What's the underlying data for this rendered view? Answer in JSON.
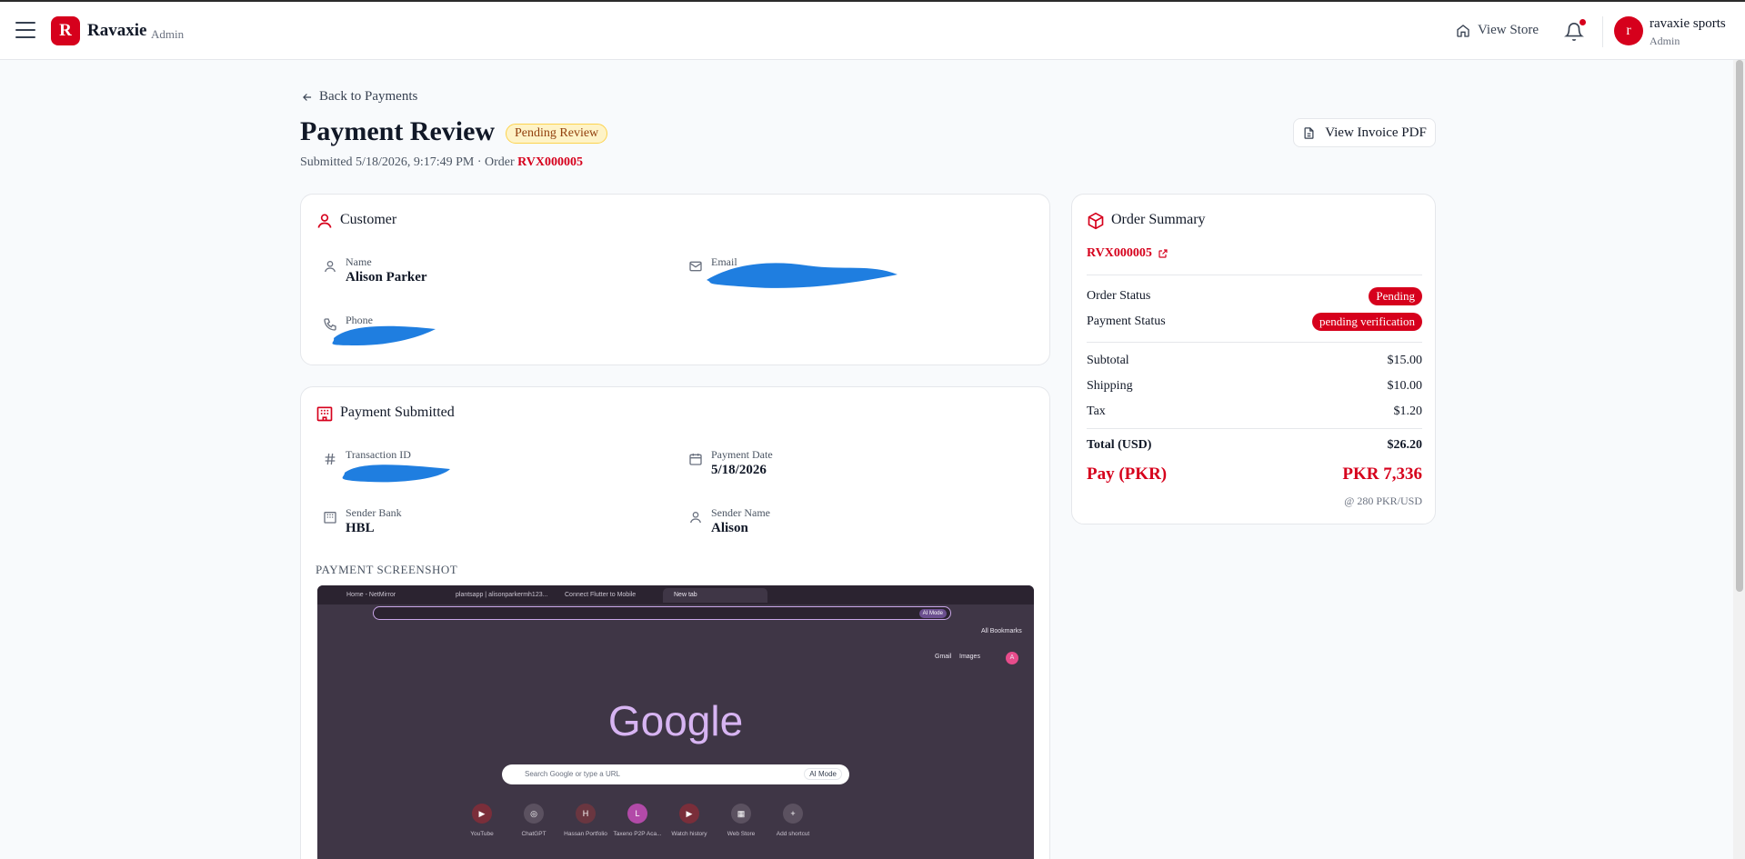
{
  "header": {
    "brand": "Ravaxie",
    "brand_sub": "Admin",
    "logo_letter": "R",
    "view_store": "View Store",
    "user_initial": "r",
    "user_name": "ravaxie sports",
    "user_role": "Admin"
  },
  "page": {
    "back_label": "Back to Payments",
    "title": "Payment Review",
    "status_badge": "Pending Review",
    "submitted_prefix": "Submitted 5/18/2026, 9:17:49 PM · Order",
    "order_id": "RVX000005",
    "invoice_button": "View Invoice PDF"
  },
  "customer": {
    "title": "Customer",
    "name_label": "Name",
    "name_value": "Alison Parker",
    "email_label": "Email",
    "phone_label": "Phone"
  },
  "payment": {
    "title": "Payment Submitted",
    "txn_label": "Transaction ID",
    "date_label": "Payment Date",
    "date_value": "5/18/2026",
    "bank_label": "Sender Bank",
    "bank_value": "HBL",
    "sender_label": "Sender Name",
    "sender_value": "Alison",
    "screenshot_label": "PAYMENT SCREENSHOT"
  },
  "screenshot": {
    "tabs": [
      "Home - NetMirror",
      "plantsapp | alisonparkermh123...",
      "Connect Flutter to Mobile",
      "New tab"
    ],
    "ai_mode": "AI Mode",
    "bookmarks": "All Bookmarks",
    "gmail": "Gmail",
    "images": "Images",
    "account_initial": "A",
    "google": "Google",
    "search_placeholder": "Search Google or type a URL",
    "shortcuts": [
      {
        "label": "YouTube",
        "glyph": "▶"
      },
      {
        "label": "ChatGPT",
        "glyph": "◎"
      },
      {
        "label": "Hassan Portfolio",
        "glyph": "H"
      },
      {
        "label": "Taxeno P2P Aca...",
        "glyph": "L"
      },
      {
        "label": "Watch history",
        "glyph": "▶"
      },
      {
        "label": "Web Store",
        "glyph": "▦"
      },
      {
        "label": "Add shortcut",
        "glyph": "+"
      }
    ]
  },
  "summary": {
    "title": "Order Summary",
    "order_link": "RVX000005",
    "order_status_label": "Order Status",
    "order_status_value": "Pending",
    "payment_status_label": "Payment Status",
    "payment_status_value": "pending verification",
    "subtotal_label": "Subtotal",
    "subtotal_value": "$15.00",
    "shipping_label": "Shipping",
    "shipping_value": "$10.00",
    "tax_label": "Tax",
    "tax_value": "$1.20",
    "total_label": "Total (USD)",
    "total_value": "$26.20",
    "pay_label": "Pay (PKR)",
    "pay_value": "PKR 7,336",
    "rate": "@ 280 PKR/USD"
  },
  "colors": {
    "brand_red": "#d6001c",
    "redaction_blue": "#1f7ee0",
    "badge_amber": "#fef3c7"
  }
}
